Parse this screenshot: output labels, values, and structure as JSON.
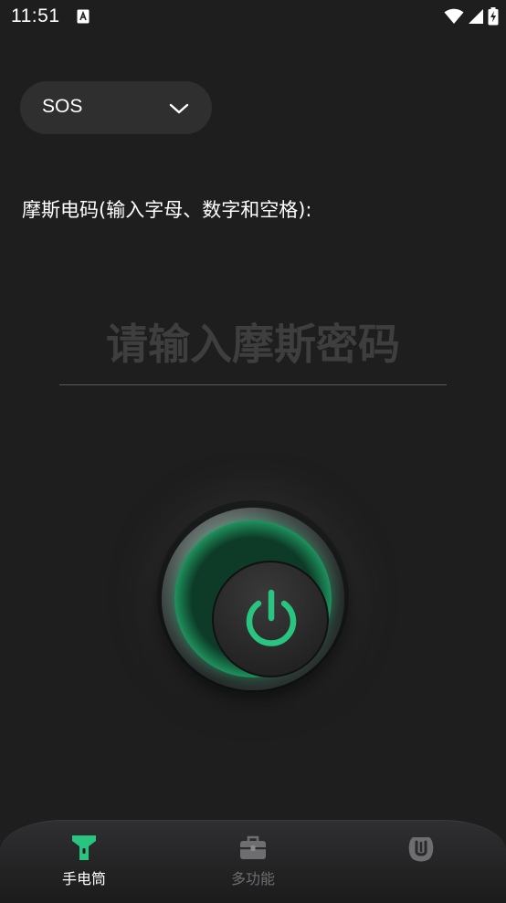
{
  "status_bar": {
    "time": "11:51",
    "icons": [
      "notification-a-icon",
      "wifi-icon",
      "signal-icon",
      "battery-charging-icon"
    ]
  },
  "mode_select": {
    "value": "SOS"
  },
  "morse": {
    "label": "摩斯电码(输入字母、数字和空格):",
    "input_value": "",
    "placeholder": "请输入摩斯密码"
  },
  "power_button": {
    "icon": "power-icon",
    "accent_color": "#29c47f"
  },
  "bottom_nav": {
    "items": [
      {
        "label": "手电筒",
        "icon": "flashlight-icon",
        "active": true
      },
      {
        "label": "多功能",
        "icon": "toolbox-icon",
        "active": false
      },
      {
        "label": "",
        "icon": "mine-icon",
        "active": false
      }
    ]
  },
  "colors": {
    "background": "#1e1e1f",
    "accent": "#29c47f",
    "inactive": "#6e6e70"
  }
}
